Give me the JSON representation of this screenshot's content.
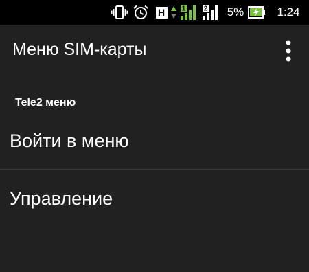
{
  "status_bar": {
    "icons": [
      "vibrate-icon",
      "alarm-icon",
      "network-h-icon",
      "data-arrows-icon",
      "signal-sim1-icon",
      "signal-sim2-icon",
      "battery-charging-icon"
    ],
    "network_type": "H",
    "sim1_label": "1",
    "sim2_label": "2",
    "battery_percent": "5%",
    "time": "1:24",
    "colors": {
      "signal_active": "#7cc242",
      "battery_fill": "#7cc242",
      "background": "#000000"
    }
  },
  "toolbar": {
    "title": "Меню SIM-карты",
    "overflow_icon": "more-vert-icon"
  },
  "section": {
    "header": "Tele2 меню"
  },
  "menu": {
    "items": [
      {
        "label": "Войти в меню"
      },
      {
        "label": "Управление"
      }
    ]
  },
  "colors": {
    "background": "#212121",
    "text": "#ffffff",
    "divider": "#3a3a3a"
  }
}
